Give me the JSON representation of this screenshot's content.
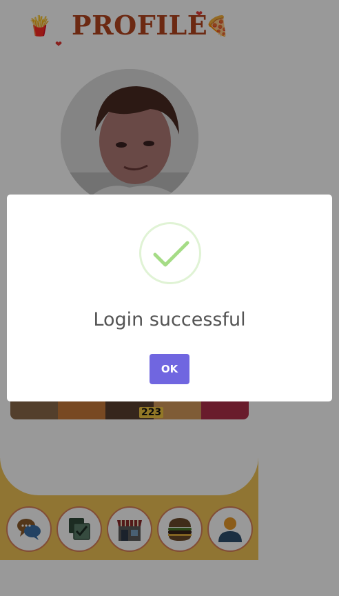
{
  "header": {
    "title": "PROFILE",
    "left_emoji": "🍟",
    "right_emoji": "🍕",
    "heart": "❤"
  },
  "profile": {
    "avatar_icon": "profile-photo"
  },
  "food_strip": {
    "badge": "223"
  },
  "bottom_nav": {
    "items": [
      {
        "name": "chat",
        "icon": "chat-bubbles-icon"
      },
      {
        "name": "checklist",
        "icon": "checklist-icon"
      },
      {
        "name": "store",
        "icon": "store-icon"
      },
      {
        "name": "burger",
        "icon": "burger-icon"
      },
      {
        "name": "profile",
        "icon": "user-icon"
      }
    ]
  },
  "dialog": {
    "title": "Login successful",
    "ok_label": "OK",
    "icon": "success-check-icon"
  },
  "colors": {
    "title": "#b5451f",
    "nav_background": "#f0c456",
    "nav_border": "#d9805b",
    "confirm_button": "#7066e0",
    "success_check": "#a5dc86",
    "overlay": "rgba(0,0,0,0.4)"
  }
}
